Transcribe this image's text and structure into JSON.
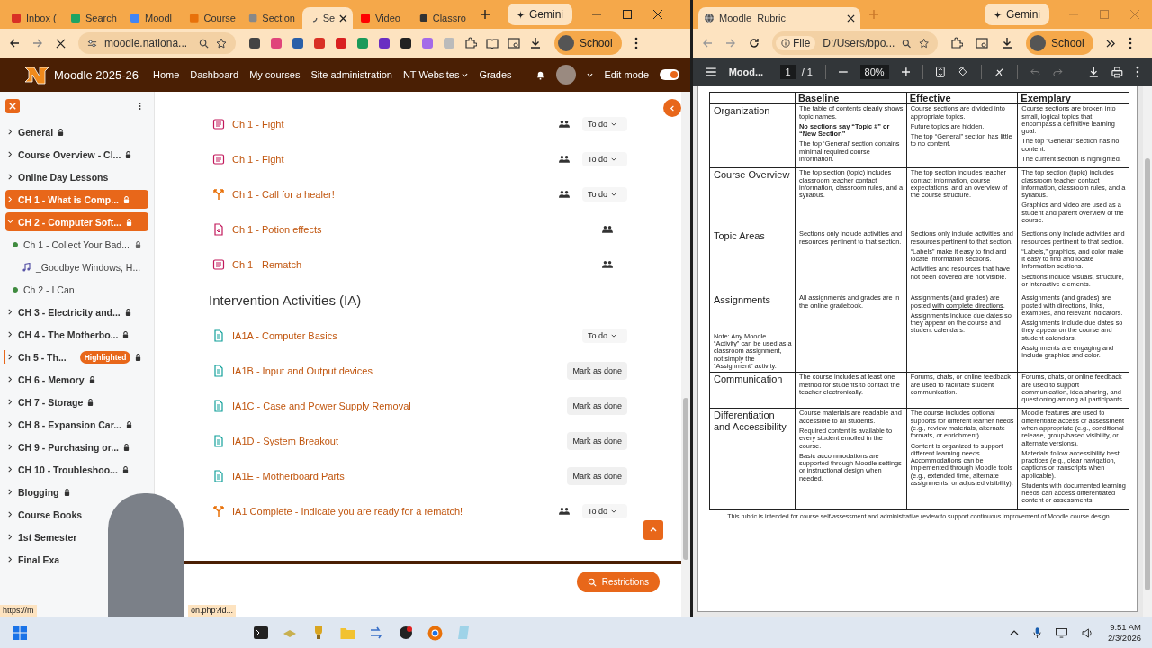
{
  "left_browser": {
    "tabs": [
      {
        "title": "Inbox (",
        "selected": false
      },
      {
        "title": "Search",
        "selected": false
      },
      {
        "title": "Moodl",
        "selected": false
      },
      {
        "title": "Course",
        "selected": false
      },
      {
        "title": "Section",
        "selected": false
      },
      {
        "title": "Se",
        "selected": true
      },
      {
        "title": "Video",
        "selected": false
      },
      {
        "title": "Classro",
        "selected": false
      }
    ],
    "gemini": "Gemini",
    "address": "moodle.nationa...",
    "profile": "School"
  },
  "moodle": {
    "site_name": "Moodle 2025-26",
    "nav": [
      {
        "label": "Home",
        "kind": "link"
      },
      {
        "label": "Dashboard",
        "kind": "link"
      },
      {
        "label": "My courses",
        "kind": "link"
      },
      {
        "label": "Site administration",
        "kind": "link"
      },
      {
        "label": "NT Websites",
        "kind": "dropdown"
      },
      {
        "label": "Grades",
        "kind": "link"
      }
    ],
    "edit_mode": {
      "label": "Edit mode",
      "on": true
    },
    "course_index": [
      {
        "label": "General",
        "kind": "section",
        "locked": true,
        "selected": false,
        "expanded": false,
        "current": false
      },
      {
        "label": "Course Overview - Cl...",
        "kind": "section",
        "locked": true,
        "selected": false,
        "expanded": false,
        "current": false
      },
      {
        "label": "Online Day Lessons",
        "kind": "section",
        "locked": false,
        "selected": false,
        "expanded": false,
        "current": false
      },
      {
        "label": "CH 1 - What is Comp...",
        "kind": "section",
        "locked": true,
        "selected": true,
        "expanded": false,
        "current": false
      },
      {
        "label": "CH 2 - Computer Soft...",
        "kind": "section",
        "locked": true,
        "selected": true,
        "expanded": true,
        "current": false,
        "children": [
          {
            "label": "Ch 1 - Collect Your Bad...",
            "kind": "activity",
            "completed": true,
            "locked": true
          },
          {
            "label": "_Goodbye Windows, H...",
            "kind": "audio",
            "locked": false
          },
          {
            "label": "Ch 2 - I Can",
            "kind": "activity",
            "completed": true,
            "locked": false
          }
        ]
      },
      {
        "label": "CH 3 - Electricity and...",
        "kind": "section",
        "locked": true,
        "selected": false,
        "expanded": false,
        "current": false
      },
      {
        "label": "CH 4 - The Motherbo...",
        "kind": "section",
        "locked": true,
        "selected": false,
        "expanded": false,
        "current": false
      },
      {
        "label": "Ch 5 - Th...",
        "kind": "section",
        "locked": true,
        "selected": false,
        "expanded": false,
        "current": true,
        "badge": "Highlighted"
      },
      {
        "label": "CH 6 - Memory",
        "kind": "section",
        "locked": true,
        "selected": false,
        "expanded": false,
        "current": false
      },
      {
        "label": "CH 7 - Storage",
        "kind": "section",
        "locked": true,
        "selected": false,
        "expanded": false,
        "current": false
      },
      {
        "label": "CH 8 - Expansion Car...",
        "kind": "section",
        "locked": true,
        "selected": false,
        "expanded": false,
        "current": false
      },
      {
        "label": "CH 9 - Purchasing or...",
        "kind": "section",
        "locked": true,
        "selected": false,
        "expanded": false,
        "current": false
      },
      {
        "label": "CH 10 - Troubleshoo...",
        "kind": "section",
        "locked": true,
        "selected": false,
        "expanded": false,
        "current": false
      },
      {
        "label": "Blogging",
        "kind": "section",
        "locked": true,
        "selected": false,
        "expanded": false,
        "current": false
      },
      {
        "label": "Course Books",
        "kind": "section",
        "locked": false,
        "selected": false,
        "expanded": false,
        "current": false
      },
      {
        "label": "1st Semester",
        "kind": "section",
        "locked": false,
        "selected": false,
        "expanded": false,
        "current": false
      },
      {
        "label": "Final Exa",
        "kind": "section",
        "locked": false,
        "selected": false,
        "expanded": false,
        "current": false
      }
    ],
    "activities": [
      {
        "kind": "lesson",
        "title": "Ch 1 - Fight",
        "groups": true,
        "completion": {
          "kind": "dropdown",
          "label": "To do"
        }
      },
      {
        "kind": "lesson",
        "title": "Ch 1 - Fight",
        "groups": true,
        "completion": {
          "kind": "dropdown",
          "label": "To do"
        }
      },
      {
        "kind": "choice",
        "title": "Ch 1 - Call for a healer!",
        "groups": true,
        "completion": {
          "kind": "dropdown",
          "label": "To do"
        }
      },
      {
        "kind": "file",
        "title": "Ch 1 - Potion effects",
        "groups": true
      },
      {
        "kind": "lesson",
        "title": "Ch 1 - Rematch",
        "groups": true
      },
      {
        "kind": "heading",
        "title": "Intervention Activities (IA)"
      },
      {
        "kind": "page",
        "title": "IA1A - Computer Basics",
        "groups": false,
        "completion": {
          "kind": "dropdown",
          "label": "To do"
        }
      },
      {
        "kind": "page",
        "title": "IA1B - Input and Output devices",
        "groups": false,
        "completion": {
          "kind": "button",
          "label": "Mark as done"
        }
      },
      {
        "kind": "page",
        "title": "IA1C - Case and Power Supply Removal",
        "groups": false,
        "completion": {
          "kind": "button",
          "label": "Mark as done"
        }
      },
      {
        "kind": "page",
        "title": "IA1D - System Breakout",
        "groups": false,
        "completion": {
          "kind": "button",
          "label": "Mark as done"
        }
      },
      {
        "kind": "page",
        "title": "IA1E - Motherboard Parts",
        "groups": false,
        "completion": {
          "kind": "button",
          "label": "Mark as done"
        }
      },
      {
        "kind": "choice",
        "title": "IA1 Complete - Indicate you are ready for a rematch!",
        "groups": true,
        "completion": {
          "kind": "dropdown",
          "label": "To do"
        }
      }
    ],
    "restrictions": "Restrictions",
    "status_url": [
      "https://m",
      "on.php?id..."
    ]
  },
  "right_browser": {
    "tab": "Moodle_Rubric",
    "gemini": "Gemini",
    "site_chip": "File",
    "address": "D:/Users/bpo...",
    "profile": "School",
    "pdf_toolbar": {
      "title": "Mood...",
      "page": "1",
      "pages": "/ 1",
      "zoom": "80%"
    }
  },
  "rubric": {
    "columns": [
      "Baseline",
      "Effective",
      "Exemplary"
    ],
    "rows": [
      {
        "criterion": "Organization",
        "cells": [
          [
            {
              "text": "The table of contents clearly shows topic names."
            },
            {
              "text": "No sections say “Topic #” or “New Section”",
              "bold": true
            },
            {
              "text": "The top ‘General’ section contains minimal required course information."
            }
          ],
          [
            {
              "text": "Course sections are divided into appropriate topics."
            },
            {
              "text": "Future topics are hidden."
            },
            {
              "text": "The top “General” section has little to no content."
            }
          ],
          [
            {
              "text": "Course sections are broken into small, logical topics that encompass a definitive learning goal."
            },
            {
              "text": "The top “General” section has no content."
            },
            {
              "text": "The current section is highlighted."
            }
          ]
        ]
      },
      {
        "criterion": "Course Overview",
        "cells": [
          [
            {
              "text": "The top section (topic) includes classroom teacher contact information, classroom rules, and a syllabus."
            }
          ],
          [
            {
              "text": "The top section includes teacher contact information, course expectations, and an overview of the course structure."
            }
          ],
          [
            {
              "text": "The top section (topic) includes classroom teacher contact information, classroom rules, and a syllabus."
            },
            {
              "text": "Graphics and video are used as a student and parent overview of the course."
            }
          ]
        ]
      },
      {
        "criterion": "Topic  Areas",
        "cells": [
          [
            {
              "text": "Sections only include activities and resources pertinent to that section."
            }
          ],
          [
            {
              "text": "Sections only include activities and resources pertinent to that section."
            },
            {
              "text": "“Labels” make it easy to find and locate Information sections."
            },
            {
              "text": "Activities and resources that have not been covered are not visible."
            }
          ],
          [
            {
              "text": "Sections only include activities and resources pertinent to that section."
            },
            {
              "text": "“Labels,” graphics, and color make it easy to find and locate Information sections."
            },
            {
              "text": "Sections include visuals, structure, or interactive elements."
            }
          ]
        ]
      },
      {
        "criterion": "Assignments",
        "note": "Note:  Any Moodle “Activity” can be used as a classroom assignment, not simply the “Assignment” activity.",
        "cells": [
          [
            {
              "text": "All assignments and grades are in the online gradebook."
            }
          ],
          [
            {
              "parts": [
                {
                  "text": "Assignments (and grades) are posted "
                },
                {
                  "text": "with complete directions",
                  "underline": true
                },
                {
                  "text": "."
                }
              ]
            },
            {
              "text": "Assignments include due dates so they appear on the course and student calendars."
            }
          ],
          [
            {
              "text": "Assignments (and grades) are posted with directions, links, examples, and relevant indicators."
            },
            {
              "text": "Assignments include due dates so they appear on the course and student calendars."
            },
            {
              "text": "Assignments are engaging and include graphics and color."
            }
          ]
        ]
      },
      {
        "criterion": "Communication",
        "cells": [
          [
            {
              "text": "The course includes at least one method for students to contact the teacher electronically."
            }
          ],
          [
            {
              "text": "Forums, chats, or online feedback are used to facilitate student communication."
            }
          ],
          [
            {
              "text": "Forums, chats, or online feedback are used to support communication, idea sharing, and questioning among all participants."
            }
          ]
        ]
      },
      {
        "criterion": "Differentiation and Accessibility",
        "cells": [
          [
            {
              "text": "Course materials are readable and accessible to all students."
            },
            {
              "text": "Required content is available to every student enrolled in the course."
            },
            {
              "text": "Basic accommodations are supported through Moodle settings or instructional design when needed."
            }
          ],
          [
            {
              "text": "The course includes optional supports for different learner needs (e.g., review materials, alternate formats, or enrichment)."
            },
            {
              "text": "Content is organized to support different learning needs. Accommodations can be implemented through Moodle tools (e.g., extended time, alternate assignments, or adjusted visibility)."
            }
          ],
          [
            {
              "text": "Moodle features are used to differentiate access or assessment when appropriate (e.g., conditional release, group-based visibility, or alternate versions)."
            },
            {
              "text": "Materials follow accessibility best practices (e.g., clear navigation, captions or transcripts when applicable)."
            },
            {
              "text": "Students with documented learning needs can access differentiated content or assessments."
            }
          ]
        ]
      }
    ],
    "footer": "This rubric is intended for course self-assessment and administrative review to support continuous improvement of Moodle course design."
  },
  "taskbar": {
    "time": "9:51 AM",
    "date": "2/3/2026"
  }
}
